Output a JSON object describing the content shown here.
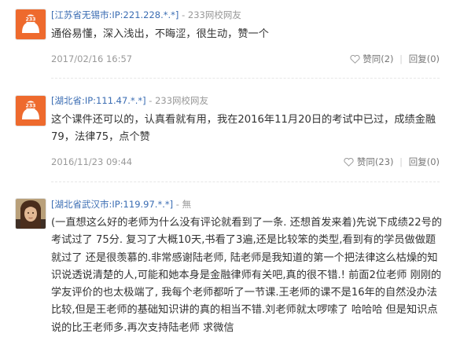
{
  "comments": [
    {
      "location": "[江苏省无锡市:IP:221.228.*.*]",
      "separator": "-",
      "user": "233网校网友",
      "text": "通俗易懂，深入浅出，不晦涩，很生动，赞一个",
      "date": "2017/02/16 16:57",
      "like_label": "赞同(2)",
      "reply_label": "回复(0)",
      "avatar": "233-logo-avatar"
    },
    {
      "location": "[湖北省:IP:111.47.*.*]",
      "separator": "-",
      "user": "233网校网友",
      "text": "这个课件还可以的，认真看就有用，我在2016年11月20日的考试中已过，成绩金融79，法律75，点个赞",
      "date": "2016/11/23 09:44",
      "like_label": "赞同(23)",
      "reply_label": "回复(0)",
      "avatar": "233-logo-avatar"
    },
    {
      "location": "[湖北省武汉市:IP:119.97.*.*]",
      "separator": "-",
      "user": "無",
      "text": "(一直想这么好的老师为什么没有评论就看到了一条. 还想首发来着)先说下成绩22号的考试过了 75分. 复习了大概10天,书看了3遍,还是比较笨的类型,看到有的学员做做题就过了 还是很羡慕的.非常感谢陆老师, 陆老师是我知道的第一个把法律这么枯燥的知识说透说清楚的人,可能和她本身是金融律师有关吧,真的很不错.! 前面2位老师 刚刚的学友评价的也太极端了, 我每个老师都听了一节课.王老师的课不是16年的自然没办法比较,但是王老师的基础知识讲的真的相当不错.刘老师就太啰嗦了 哈哈哈 但是知识点说的比王老师多.再次支持陆老师 求微信",
      "avatar": "portrait-avatar"
    }
  ],
  "colors": {
    "location": "#3b6db3",
    "meta": "#999999",
    "text": "#333333",
    "logo_orange": "#ee6a2d"
  }
}
